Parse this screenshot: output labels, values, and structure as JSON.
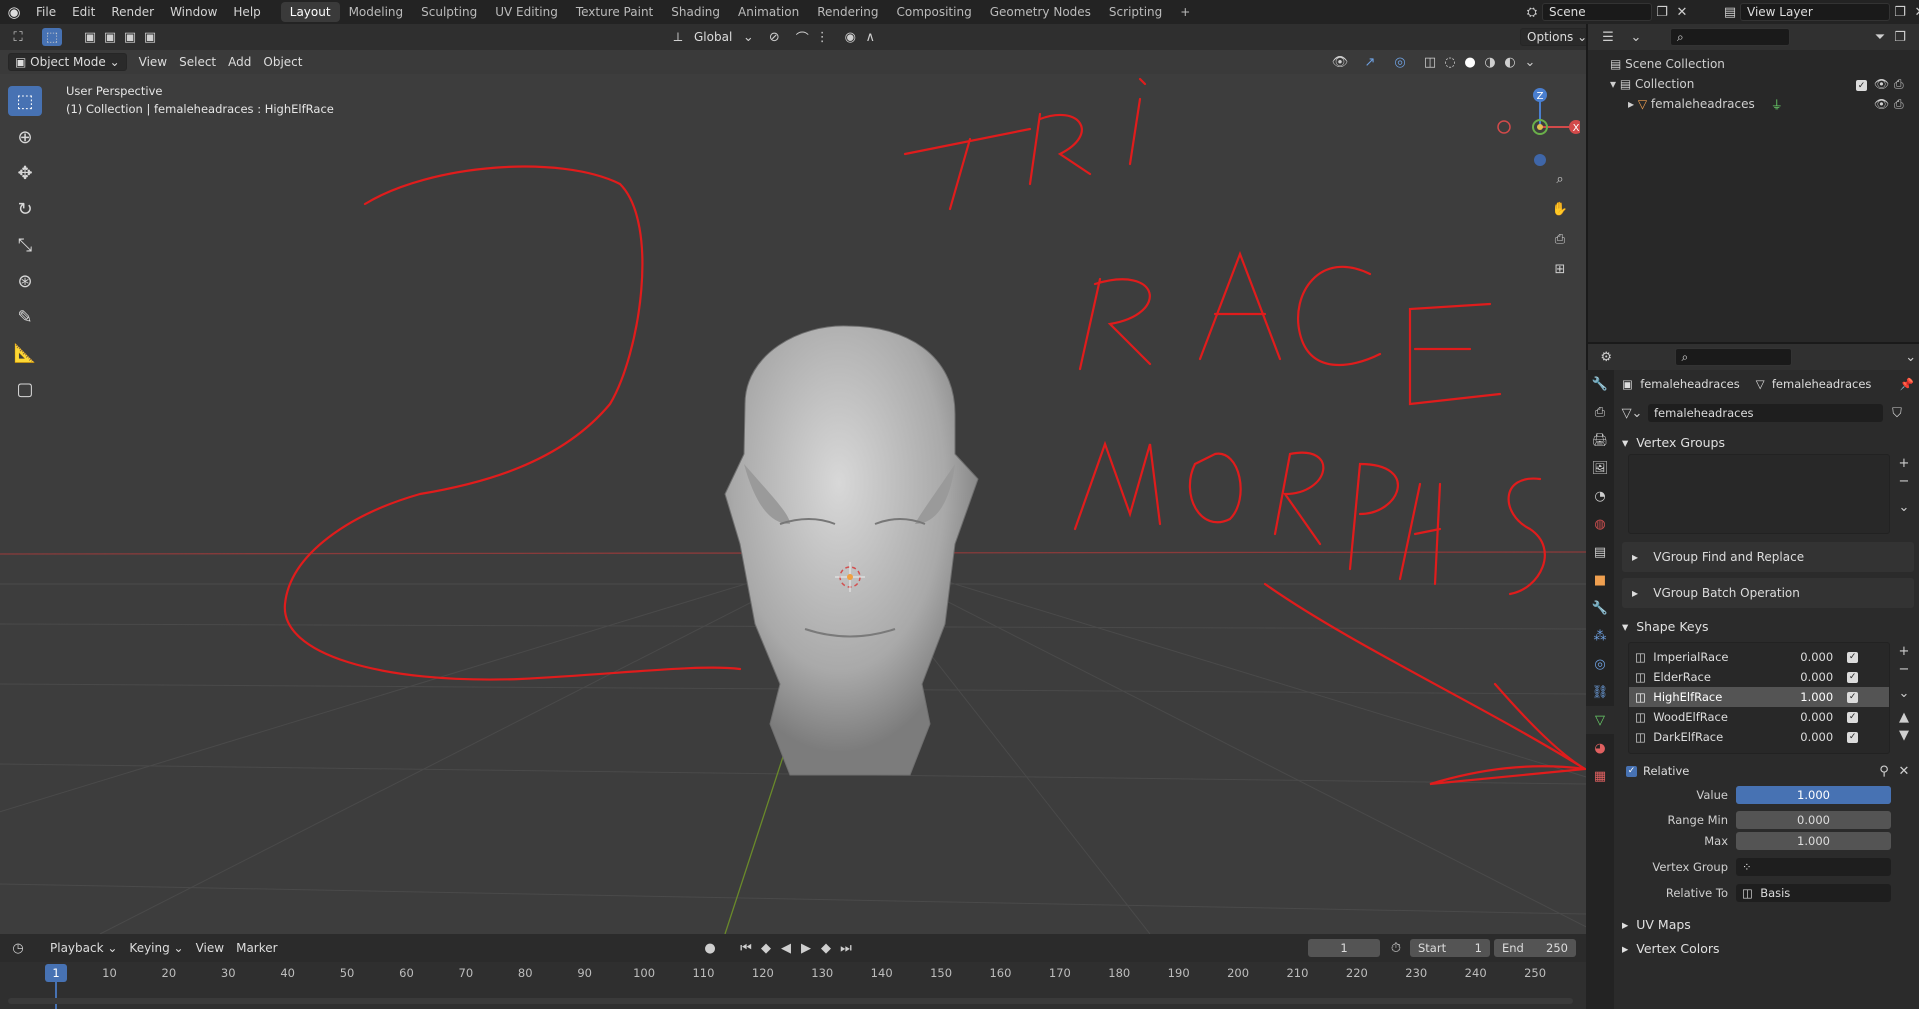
{
  "app": {
    "menus": [
      "File",
      "Edit",
      "Render",
      "Window",
      "Help"
    ]
  },
  "workspaces": [
    "Layout",
    "Modeling",
    "Sculpting",
    "UV Editing",
    "Texture Paint",
    "Shading",
    "Animation",
    "Rendering",
    "Compositing",
    "Geometry Nodes",
    "Scripting"
  ],
  "active_workspace": "Layout",
  "scene": "Scene",
  "view_layer": "View Layer",
  "viewport": {
    "transform_orientation": "Global",
    "options_label": "Options",
    "mode": "Object Mode",
    "menus": [
      "View",
      "Select",
      "Add",
      "Object"
    ],
    "overlay_title": "User Perspective",
    "overlay_subtitle": "(1) Collection | femaleheadraces : HighElfRace",
    "axes": {
      "x": "X",
      "y": "Y",
      "z": "Z"
    },
    "annotation_text": [
      "TRI",
      "RACE",
      "MORPHS"
    ],
    "annotation_color": "#e01c1c"
  },
  "outliner": {
    "search_placeholder": "",
    "items": [
      {
        "label": "Scene Collection",
        "icon": "scene-collection-icon"
      },
      {
        "label": "Collection",
        "icon": "collection-icon"
      },
      {
        "label": "femaleheadraces",
        "icon": "mesh-object-icon"
      }
    ]
  },
  "properties": {
    "breadcrumb_object": "femaleheadraces",
    "breadcrumb_data": "femaleheadraces",
    "data_name": "femaleheadraces",
    "vertex_groups_title": "Vertex Groups",
    "subpanels": [
      "VGroup Find and Replace",
      "VGroup Batch Operation"
    ],
    "shape_keys_title": "Shape Keys",
    "shape_keys": [
      {
        "name": "ImperialRace",
        "value": "0.000",
        "selected": false
      },
      {
        "name": "ElderRace",
        "value": "0.000",
        "selected": false
      },
      {
        "name": "HighElfRace",
        "value": "1.000",
        "selected": true
      },
      {
        "name": "WoodElfRace",
        "value": "0.000",
        "selected": false
      },
      {
        "name": "DarkElfRace",
        "value": "0.000",
        "selected": false
      }
    ],
    "relative_label": "Relative",
    "value_label": "Value",
    "value": "1.000",
    "value_fraction": 1.0,
    "range_min_label": "Range Min",
    "range_min": "0.000",
    "max_label": "Max",
    "max": "1.000",
    "vertex_group_label": "Vertex Group",
    "relative_to_label": "Relative To",
    "relative_to": "Basis",
    "uv_maps_title": "UV Maps",
    "vertex_colors_title": "Vertex Colors"
  },
  "timeline": {
    "menus": [
      "Playback",
      "Keying",
      "View",
      "Marker"
    ],
    "current_frame": "1",
    "start_label": "Start",
    "start": "1",
    "end_label": "End",
    "end": "250",
    "ticks": [
      "1",
      "10",
      "20",
      "30",
      "40",
      "50",
      "60",
      "70",
      "80",
      "90",
      "100",
      "110",
      "120",
      "130",
      "140",
      "150",
      "160",
      "170",
      "180",
      "190",
      "200",
      "210",
      "220",
      "230",
      "240",
      "250"
    ],
    "playhead_frame": "1"
  }
}
